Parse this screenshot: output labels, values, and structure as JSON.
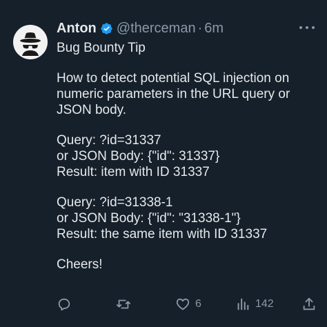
{
  "tweet": {
    "author": {
      "name": "Anton",
      "handle": "@therceman",
      "separator": "·",
      "time": "6m",
      "avatar_icon": "hacker-hat-sunglasses-icon",
      "verified_icon": "verified-badge-icon",
      "verified_color": "#1d9bf0"
    },
    "text_lines": [
      "Bug Bounty Tip",
      "",
      "How to detect potential SQL injection on",
      "numeric parameters in the URL query or",
      "JSON body.",
      "",
      "Query: ?id=31337",
      "or JSON Body: {\"id\": 31337}",
      "Result: item with ID 31337",
      "",
      "Query: ?id=31338-1",
      "or JSON Body: {\"id\": \"31338-1\"}",
      "Result: the same item with ID 31337",
      "",
      "Cheers!"
    ],
    "actions": {
      "reply": {
        "icon": "reply-icon",
        "count": ""
      },
      "retweet": {
        "icon": "retweet-icon",
        "count": ""
      },
      "like": {
        "icon": "heart-icon",
        "count": "6"
      },
      "views": {
        "icon": "views-chart-icon",
        "count": "142"
      },
      "share": {
        "icon": "share-icon"
      }
    }
  },
  "colors": {
    "background": "#15202b",
    "text": "#e7e9ea",
    "secondary": "#8b98a5"
  }
}
